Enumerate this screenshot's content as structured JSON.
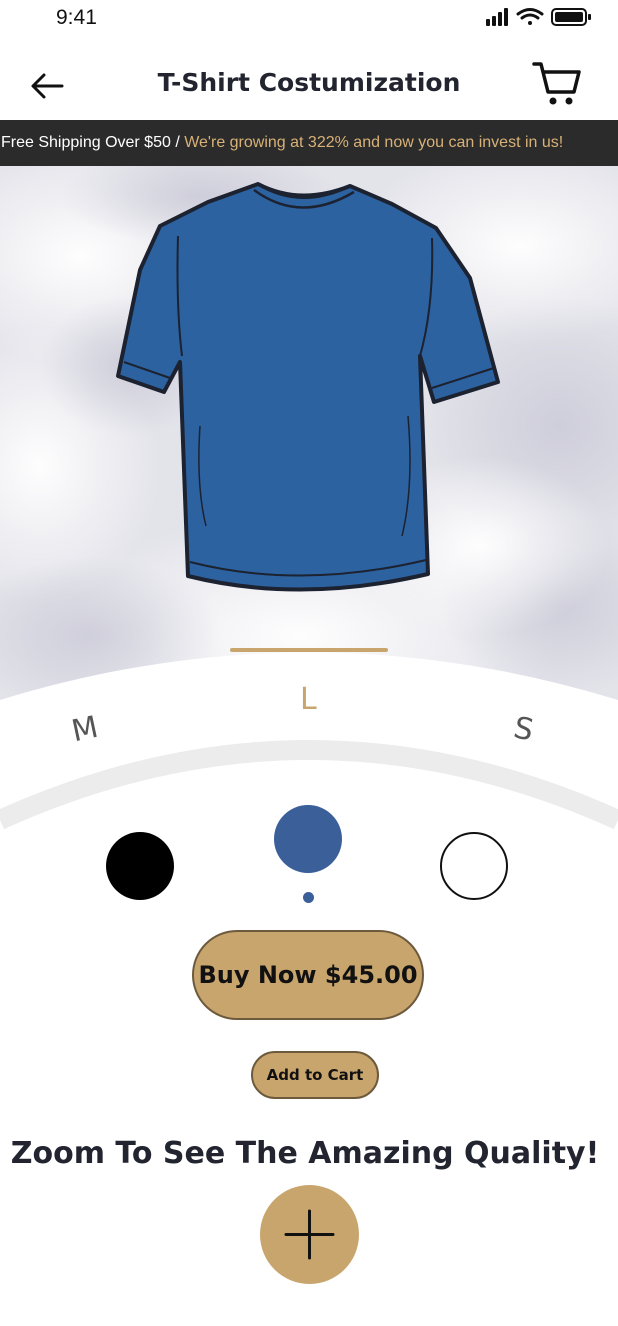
{
  "status_bar": {
    "time": "9:41",
    "icons": [
      "signal-icon",
      "wifi-icon",
      "battery-icon"
    ]
  },
  "header": {
    "title": "T-Shirt Costumization",
    "back_icon": "arrow-left-icon",
    "cart_icon": "cart-icon"
  },
  "banner": {
    "part1": "Free Shipping Over $50",
    "separator": " / ",
    "part2": "We're growing at 322% and now you can invest in us!"
  },
  "product": {
    "image": "blue-tshirt",
    "background": "clouds"
  },
  "sizes": {
    "options": [
      "M",
      "L",
      "S"
    ],
    "selected": "L"
  },
  "colors": {
    "options": [
      {
        "name": "black",
        "hex": "#000000"
      },
      {
        "name": "blue",
        "hex": "#3a5f99"
      },
      {
        "name": "white",
        "hex": "#ffffff"
      }
    ],
    "selected": "blue"
  },
  "actions": {
    "buy_label": "Buy Now $45.00",
    "add_to_cart_label": "Add to Cart"
  },
  "zoom": {
    "heading": "Zoom To See The Amazing Quality!",
    "icon": "plus-icon"
  },
  "theme": {
    "accent": "#c9a56e",
    "banner_bg": "#2b2b2b",
    "tshirt": "#2d62a0"
  }
}
